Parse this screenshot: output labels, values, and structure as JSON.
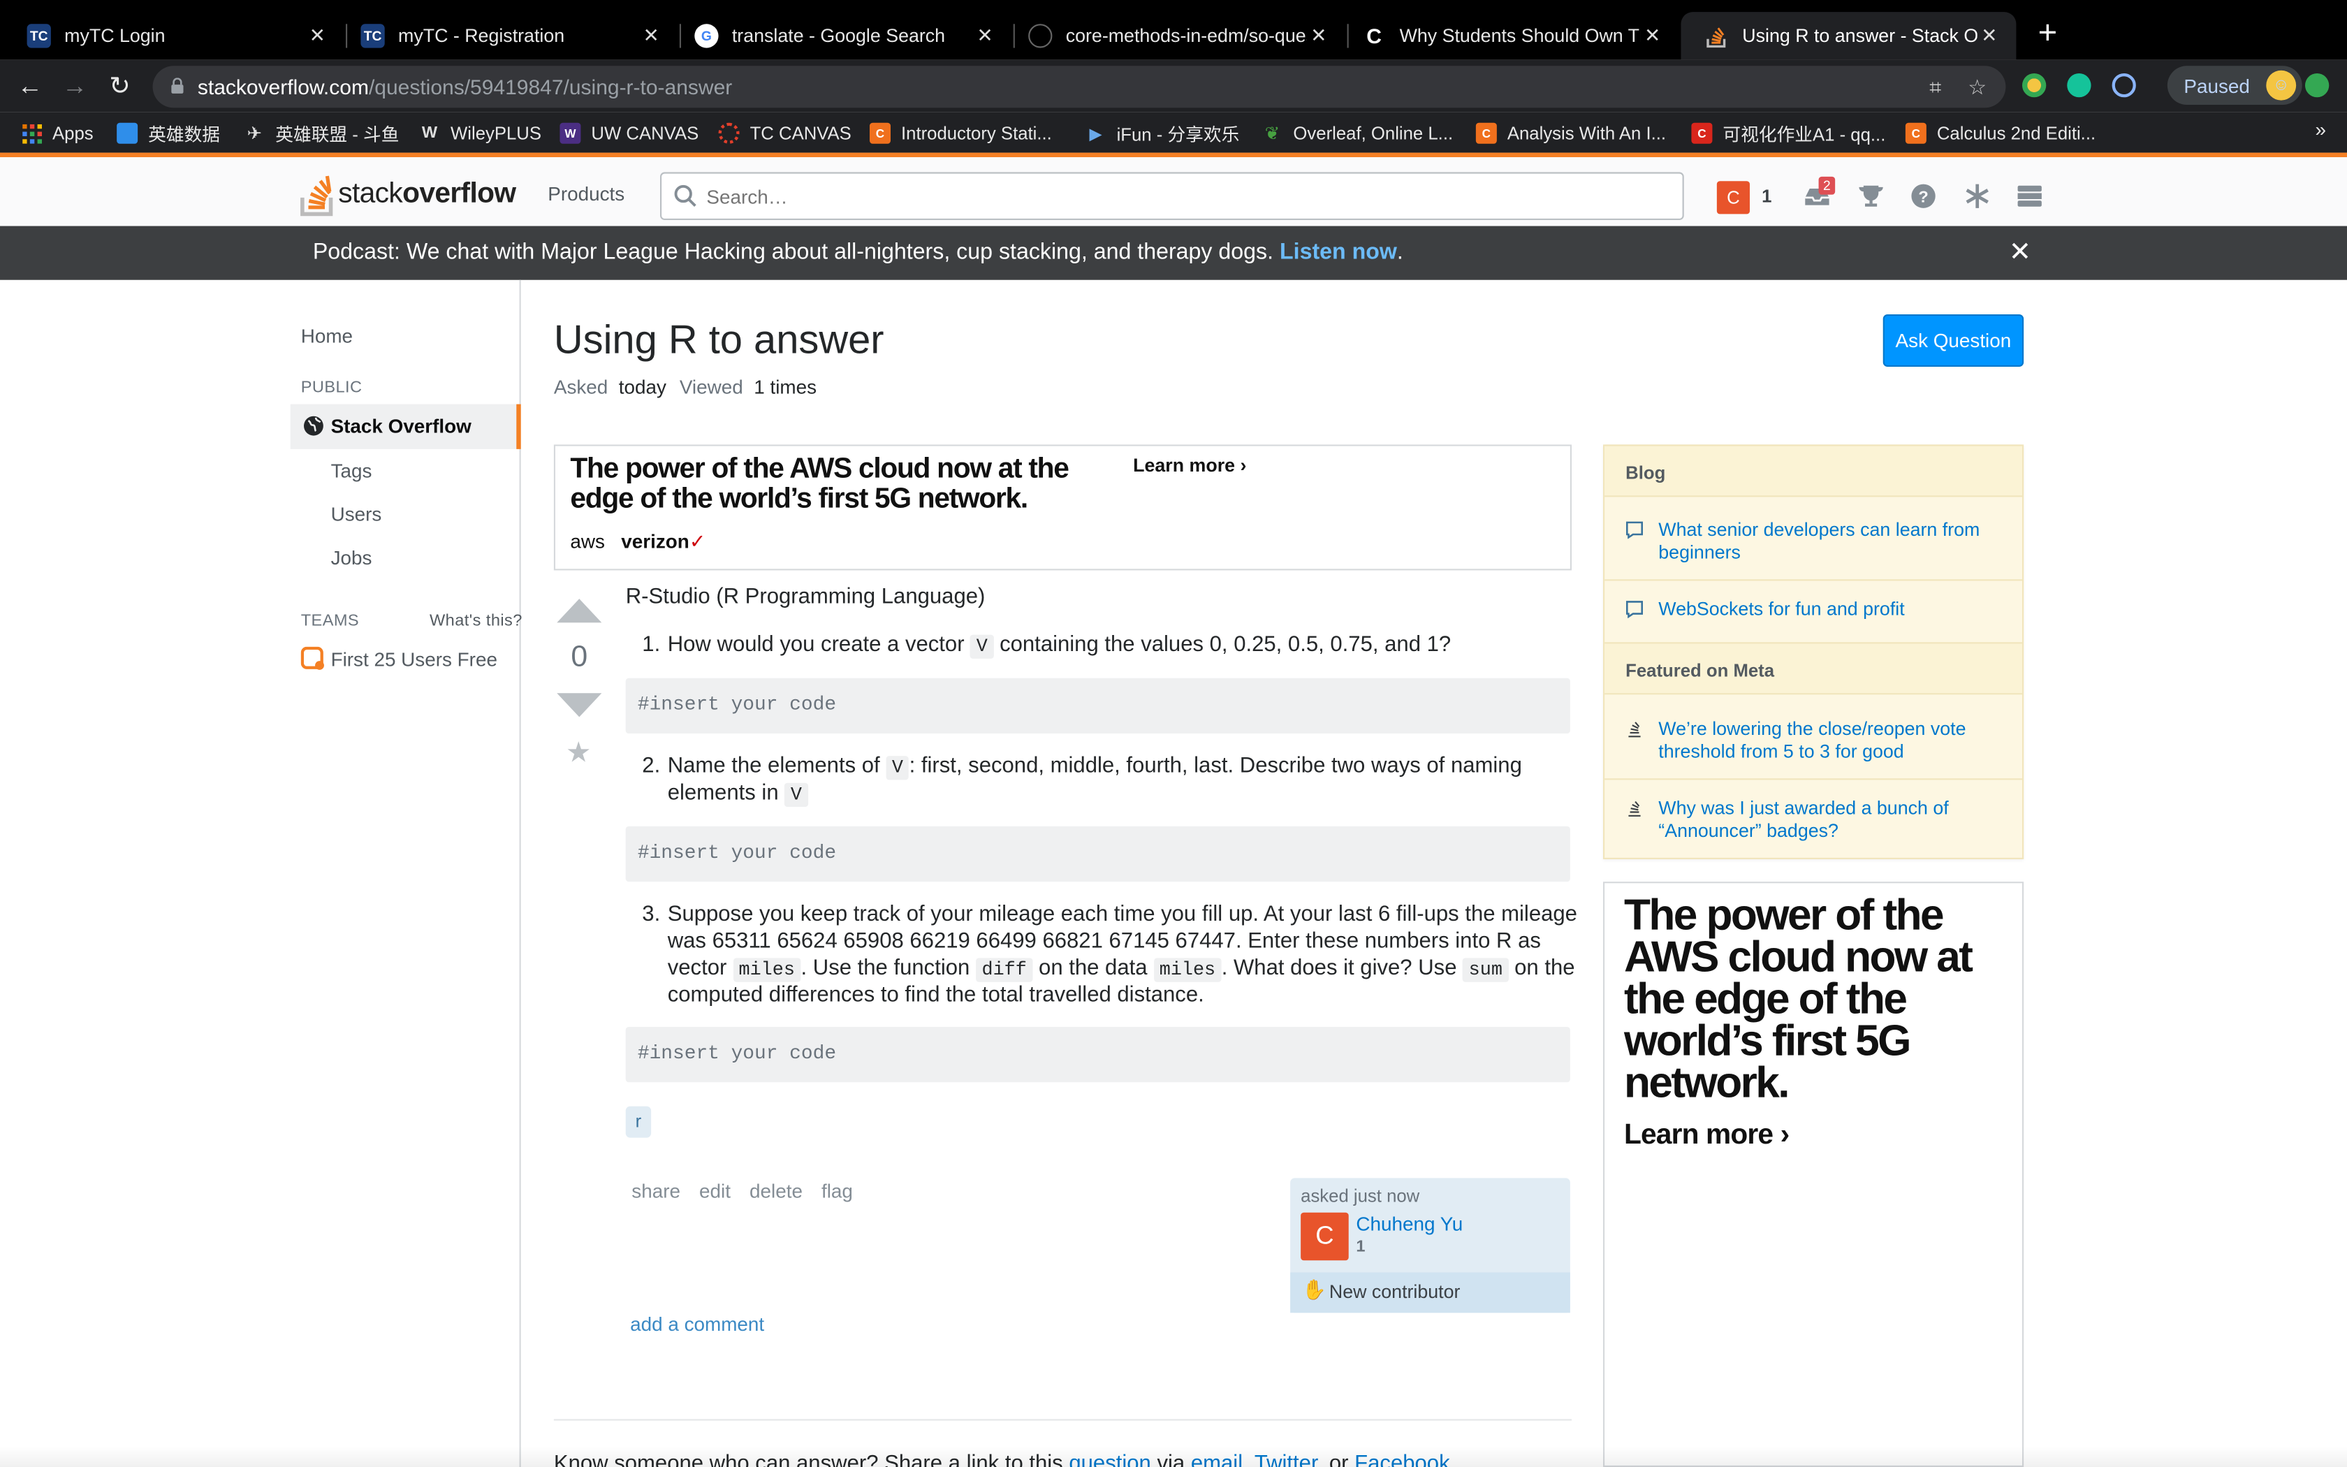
{
  "browser": {
    "tabs": [
      {
        "title": "myTC Login",
        "icon": "tc-icon"
      },
      {
        "title": "myTC - Registration",
        "icon": "tc-icon"
      },
      {
        "title": "translate - Google Search",
        "icon": "google-icon"
      },
      {
        "title": "core-methods-in-edm/so-ques",
        "icon": "github-icon"
      },
      {
        "title": "Why Students Should Own The",
        "icon": "c-icon"
      },
      {
        "title": "Using R to answer - Stack Ove",
        "icon": "stackoverflow-icon"
      }
    ],
    "url_host": "stackoverflow.com",
    "url_path": "/questions/59419847/using-r-to-answer",
    "paused_label": "Paused",
    "bookmarks": [
      {
        "label": "Apps"
      },
      {
        "label": "英雄数据"
      },
      {
        "label": "英雄联盟 - 斗鱼"
      },
      {
        "label": "WileyPLUS"
      },
      {
        "label": "UW CANVAS"
      },
      {
        "label": "TC CANVAS"
      },
      {
        "label": "Introductory Stati..."
      },
      {
        "label": "iFun - 分享欢乐"
      },
      {
        "label": "Overleaf, Online L..."
      },
      {
        "label": "Analysis With An I..."
      },
      {
        "label": "可视化作业A1 - qq..."
      },
      {
        "label": "Calculus 2nd Editi..."
      }
    ],
    "bookmarks_more": "»"
  },
  "topbar": {
    "logo_text_1": "stack",
    "logo_text_2": "overflow",
    "products_label": "Products",
    "search_placeholder": "Search…",
    "user_initial": "C",
    "reputation": "1",
    "inbox_count": "2"
  },
  "banner": {
    "text": "Podcast: We chat with Major League Hacking about all-nighters, cup stacking, and therapy dogs. ",
    "link": "Listen now",
    "suffix": ".",
    "close": "✕"
  },
  "leftnav": {
    "home": "Home",
    "public_heading": "PUBLIC",
    "stackoverflow": "Stack Overflow",
    "tags": "Tags",
    "users": "Users",
    "jobs": "Jobs",
    "teams_heading": "TEAMS",
    "whats_this": "What's this?",
    "teams_item": "First 25 Users Free"
  },
  "question": {
    "title": "Using R to answer",
    "asked_label": "Asked",
    "asked_value": "today",
    "viewed_label": "Viewed",
    "viewed_value": "1 times",
    "ask_button": "Ask Question",
    "votes": "0",
    "intro": "R-Studio (R Programming Language)",
    "q1_num": "1.",
    "q1_a": "How would you create a vector ",
    "q1_code": "V",
    "q1_b": " containing the values 0, 0.25, 0.5, 0.75, and 1?",
    "code1": "#insert your code",
    "q2_num": "2.",
    "q2_a": "Name the elements of ",
    "q2_code": "V",
    "q2_b": ": first, second, middle, fourth, last. Describe two ways of naming",
    "q2_c": "elements in ",
    "q2_code2": "V",
    "code2": "#insert your code",
    "q3_num": "3.",
    "q3_l1": "Suppose you keep track of your mileage each time you fill up. At your last 6 fill-ups the mileage",
    "q3_l2": "was 65311 65624 65908 66219 66499 66821 67145 67447. Enter these numbers into R as",
    "q3_l3a": "vector ",
    "q3_l3code1": "miles",
    "q3_l3b": ". Use the function ",
    "q3_l3code2": "diff",
    "q3_l3c": " on the data ",
    "q3_l3code3": "miles",
    "q3_l3d": ". What does it give? Use ",
    "q3_l3code4": "sum",
    "q3_l3e": " on the",
    "q3_l4": "computed differences to find the total travelled distance.",
    "code3": "#insert your code",
    "tag": "r",
    "actions": {
      "share": "share",
      "edit": "edit",
      "delete": "delete",
      "flag": "flag"
    },
    "asked_time": "asked just now",
    "author": "Chuheng Yu",
    "author_rep": "1",
    "author_initial": "C",
    "new_contributor": "New contributor",
    "add_comment": "add a comment",
    "share_prefix": "Know someone who can answer? Share a link to this ",
    "share_question": "question",
    "share_via": " via ",
    "share_email": "email",
    "share_comma": ", ",
    "share_twitter": "Twitter",
    "share_or": ", or ",
    "share_facebook": "Facebook"
  },
  "ad": {
    "top_headline": "The power of the AWS cloud now at the edge of the world’s first 5G network.",
    "learn_more": "Learn more",
    "brand_aws": "aws",
    "brand_verizon": "verizon",
    "side_headline": "The power of the AWS cloud now at the edge of the world’s first 5G network.",
    "side_learn_more": "Learn more"
  },
  "sidebar": {
    "blog_heading": "Blog",
    "blog_items": [
      "What senior developers can learn from beginners",
      "WebSockets for fun and profit"
    ],
    "meta_heading": "Featured on Meta",
    "meta_items": [
      "We’re lowering the close/reopen vote threshold from 5 to 3 for good",
      "Why was I just awarded a bunch of “Announcer” badges?"
    ]
  },
  "colors": {
    "accent": "#f48024",
    "link": "#0077cc",
    "button": "#0095ff",
    "banner": "#3d3f41"
  }
}
